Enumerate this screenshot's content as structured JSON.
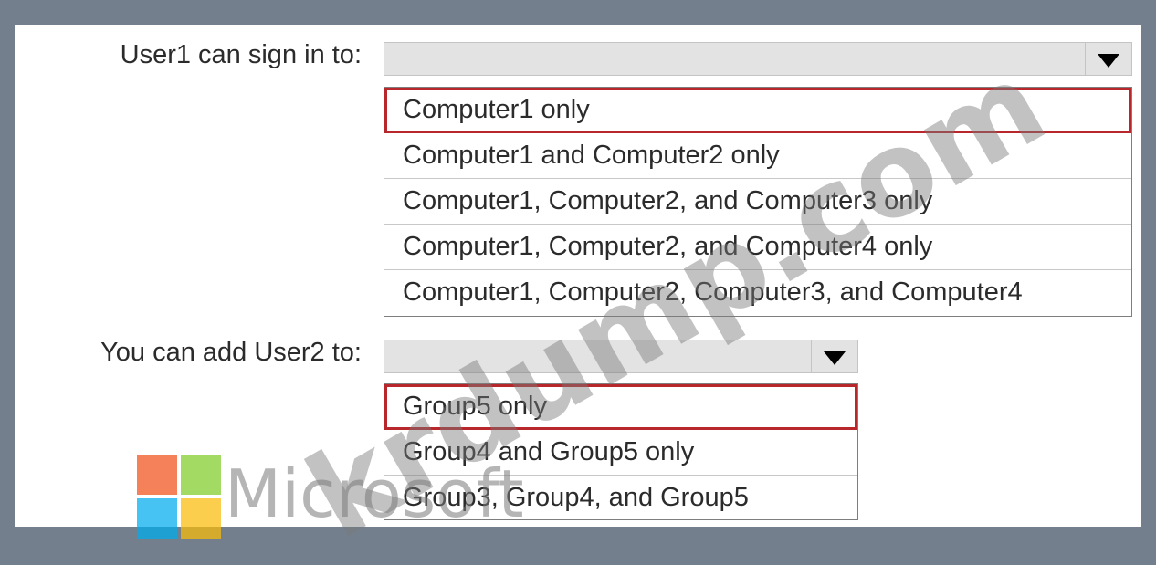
{
  "question1": {
    "label": "User1 can sign in to:",
    "selected_value": "",
    "options": [
      "Computer1 only",
      "Computer1 and Computer2 only",
      "Computer1, Computer2, and Computer3 only",
      "Computer1, Computer2, and Computer4 only",
      "Computer1, Computer2, Computer3, and Computer4"
    ],
    "highlighted_option": "Computer1 only"
  },
  "question2": {
    "label": "You can add User2 to:",
    "selected_value": "",
    "options": [
      "Group5 only",
      "Group4 and Group5 only",
      "Group3, Group4, and Group5"
    ],
    "highlighted_option": "Group5 only"
  },
  "branding": {
    "logo_text": "Microsoft",
    "watermark_text": "krdump.com"
  },
  "colors": {
    "frame": "#737f8c",
    "highlight_border": "#b8272c",
    "dropdown_background": "#e3e3e3"
  },
  "icons": {
    "dropdown_arrow": "triangle-down-icon"
  }
}
